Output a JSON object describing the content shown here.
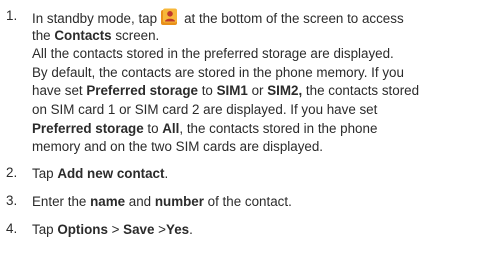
{
  "steps": [
    {
      "number": "1.",
      "lines": [
        {
          "a": "In standby mode, tap",
          "icon": "contacts-app-icon",
          "b": "at the bottom of the screen to access"
        },
        {
          "a": "the ",
          "b1": "Contacts",
          "c": " screen."
        },
        {
          "text": "All the contacts stored in the preferred storage are displayed."
        },
        {
          "text": "By default, the contacts are stored in the phone memory. If you"
        },
        {
          "a": "have set ",
          "b1": "Preferred storage",
          "c": " to ",
          "b2": "SIM1",
          "d": " or ",
          "b3": "SIM2,",
          "e": " the contacts stored"
        },
        {
          "text": "on SIM card 1 or SIM card 2 are displayed. If you have set"
        },
        {
          "b1": "Preferred storage",
          "c": " to ",
          "b2": "All",
          "d": ", the contacts stored in the phone"
        },
        {
          "text": "memory and on the two SIM cards are displayed."
        }
      ]
    },
    {
      "number": "2.",
      "a": "Tap ",
      "b1": "Add new contact",
      "c": "."
    },
    {
      "number": "3.",
      "a": "Enter the ",
      "b1": "name",
      "c": " and ",
      "b2": "number",
      "d": " of the contact."
    },
    {
      "number": "4.",
      "a": "Tap ",
      "b1": "Options",
      "c": " > ",
      "b2": "Save",
      "d": " >",
      "b3": "Yes",
      "e": "."
    }
  ],
  "colors": {
    "text": "#2b2b2b",
    "icon_orange": "#f0a020",
    "icon_red": "#d8402a"
  }
}
